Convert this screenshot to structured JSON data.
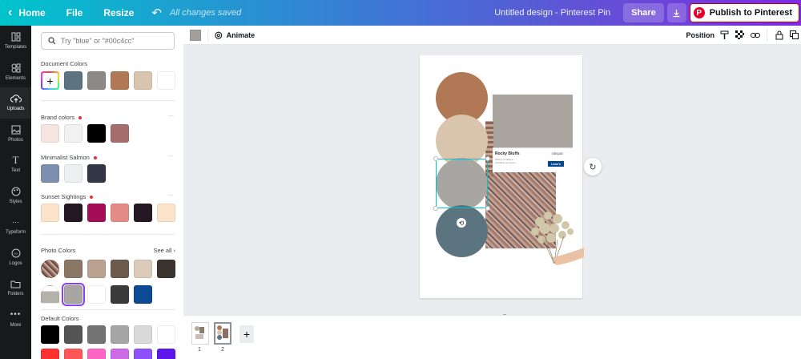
{
  "topbar": {
    "home": "Home",
    "file": "File",
    "resize": "Resize",
    "saved_status": "All changes saved",
    "title": "Untitled design - Pinterest Pin",
    "share": "Share",
    "publish": "Publish to Pinterest"
  },
  "rail": [
    {
      "label": "Templates",
      "icon": "templates-icon"
    },
    {
      "label": "Elements",
      "icon": "elements-icon"
    },
    {
      "label": "Uploads",
      "icon": "uploads-icon"
    },
    {
      "label": "Photos",
      "icon": "photos-icon"
    },
    {
      "label": "Text",
      "icon": "text-icon"
    },
    {
      "label": "Styles",
      "icon": "styles-icon"
    },
    {
      "label": "Typeform",
      "icon": "typeform-icon"
    },
    {
      "label": "Logos",
      "icon": "logos-icon"
    },
    {
      "label": "Folders",
      "icon": "folders-icon"
    },
    {
      "label": "More",
      "icon": "more-icon"
    }
  ],
  "panel": {
    "search_placeholder": "Try \"blue\" or \"#00c4cc\"",
    "document_colors_title": "Document Colors",
    "document_colors": [
      "#5b7480",
      "#8a8987",
      "#b17855",
      "#d9c4ae",
      "#ffffff"
    ],
    "brand_colors_title": "Brand colors",
    "brand_colors": [
      "#f6e4df",
      "#f1f1f1",
      "#000000",
      "#a56d6c"
    ],
    "minimalist_title": "Minimalist Salmon",
    "minimalist_colors": [
      "#7d8fae",
      "#edf0f1",
      "#313745"
    ],
    "sunset_title": "Sunset Sightings",
    "sunset_colors": [
      "#fbe4c9",
      "#241822",
      "#a50c57",
      "#e38c86",
      "#241822",
      "#fbe4c9"
    ],
    "photo_colors_title": "Photo Colors",
    "see_all": "See all",
    "photo_colors_row1": [
      "#8b7766",
      "#b9a290",
      "#6c5a4c",
      "#dccbb8",
      "#3b332d"
    ],
    "photo_colors_row2": [
      "#a8a6a3",
      "#ffffff",
      "#3a3a3a",
      "#0d4a96"
    ],
    "default_colors_title": "Default Colors",
    "default_colors": [
      "#000000",
      "#545454",
      "#737373",
      "#a6a6a6",
      "#d9d9d9",
      "#ffffff"
    ],
    "default_colors_row2": [
      "#ff3131",
      "#ff5757",
      "#ff66c4",
      "#cb6ce6",
      "#8c52ff",
      "#5e17eb"
    ]
  },
  "toolbar": {
    "animate": "Animate",
    "position": "Position",
    "fill_color": "#a39e98"
  },
  "canvas": {
    "circles": [
      "#b17855",
      "#d9c4ae",
      "#a8a6a3",
      "#5b7480"
    ],
    "card_title": "Rocky Bluffs",
    "card_brand": "valspar",
    "card_lowes": "Lowe's",
    "card_sub_1": "2022-1-3 Valspar",
    "card_sub_2": "Available at Lowe's"
  },
  "pages": [
    {
      "number": "1"
    },
    {
      "number": "2"
    }
  ]
}
